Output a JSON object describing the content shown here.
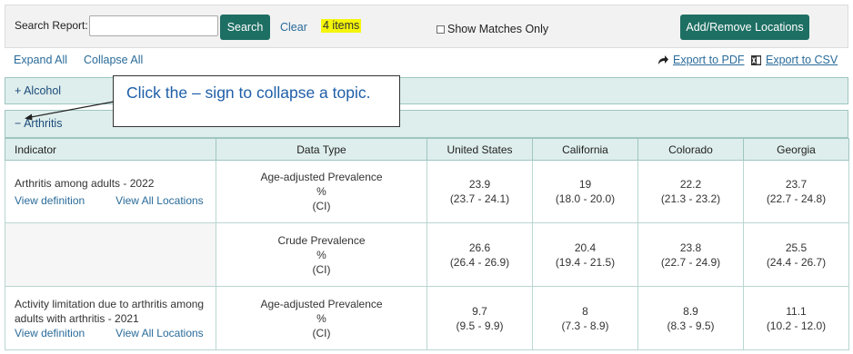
{
  "search": {
    "label": "Search Report:",
    "placeholder": "",
    "value": "",
    "button_label": "Search",
    "clear_label": "Clear",
    "items_badge": "4 items",
    "show_matches_label": "Show Matches Only",
    "add_remove_label": "Add/Remove Locations"
  },
  "toolbar": {
    "expand_all": "Expand All",
    "collapse_all": "Collapse All",
    "export_pdf": "Export to PDF",
    "export_csv": "Export to CSV"
  },
  "sections": {
    "alcohol": "+ Alcohol",
    "arthritis": "− Arthritis"
  },
  "callout": {
    "text": "Click the – sign to collapse a topic."
  },
  "table": {
    "headers": [
      "Indicator",
      "Data Type",
      "United States",
      "California",
      "Colorado",
      "Georgia"
    ],
    "view_definition": "View definition",
    "view_all_locations": "View All Locations",
    "rows": [
      {
        "indicator": "Arthritis among adults - 2022",
        "dtype": [
          "Age-adjusted Prevalence",
          "%",
          "(CI)"
        ],
        "values": [
          [
            "23.9",
            "(23.7 - 24.1)"
          ],
          [
            "19",
            "(18.0 - 20.0)"
          ],
          [
            "22.2",
            "(21.3 - 23.2)"
          ],
          [
            "23.7",
            "(22.7 - 24.8)"
          ]
        ]
      },
      {
        "indicator": "",
        "dtype": [
          "Crude Prevalence",
          "%",
          "(CI)"
        ],
        "values": [
          [
            "26.6",
            "(26.4 - 26.9)"
          ],
          [
            "20.4",
            "(19.4 - 21.5)"
          ],
          [
            "23.8",
            "(22.7 - 24.9)"
          ],
          [
            "25.5",
            "(24.4 - 26.7)"
          ]
        ]
      },
      {
        "indicator_line1": "Activity limitation due to arthritis among",
        "indicator_line2": "adults with arthritis - 2021",
        "dtype": [
          "Age-adjusted Prevalence",
          "%",
          "(CI)"
        ],
        "values": [
          [
            "9.7",
            "(9.5 - 9.9)"
          ],
          [
            "8",
            "(7.3 - 8.9)"
          ],
          [
            "8.9",
            "(8.3 - 9.5)"
          ],
          [
            "11.1",
            "(10.2 - 12.0)"
          ]
        ]
      }
    ]
  },
  "colors": {
    "primary_button": "#1e6f63",
    "link": "#2a6b9a",
    "highlight": "#f5f50a",
    "section_bg": "#deeeec",
    "callout_text": "#1f5fa8"
  },
  "icons": {
    "export_pdf": "share-arrow-icon",
    "export_csv": "excel-icon"
  }
}
